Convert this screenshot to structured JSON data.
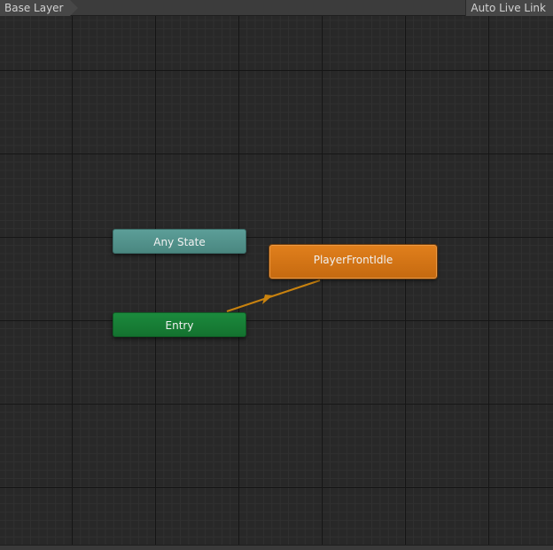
{
  "toolbar": {
    "layer_breadcrumb": "Base Layer",
    "auto_live_link_label": "Auto Live Link"
  },
  "graph": {
    "states": {
      "any_state": "Any State",
      "entry": "Entry",
      "default_state": "PlayerFrontIdle"
    },
    "transitions": [
      {
        "from": "Entry",
        "to": "PlayerFrontIdle",
        "color": "#c8820f"
      }
    ]
  },
  "colors": {
    "canvas_background": "#282828",
    "any_state_node": "#5a9b95",
    "entry_node": "#1a8a3c",
    "default_state_node": "#d97a18",
    "transition_arrow": "#c8820f"
  }
}
